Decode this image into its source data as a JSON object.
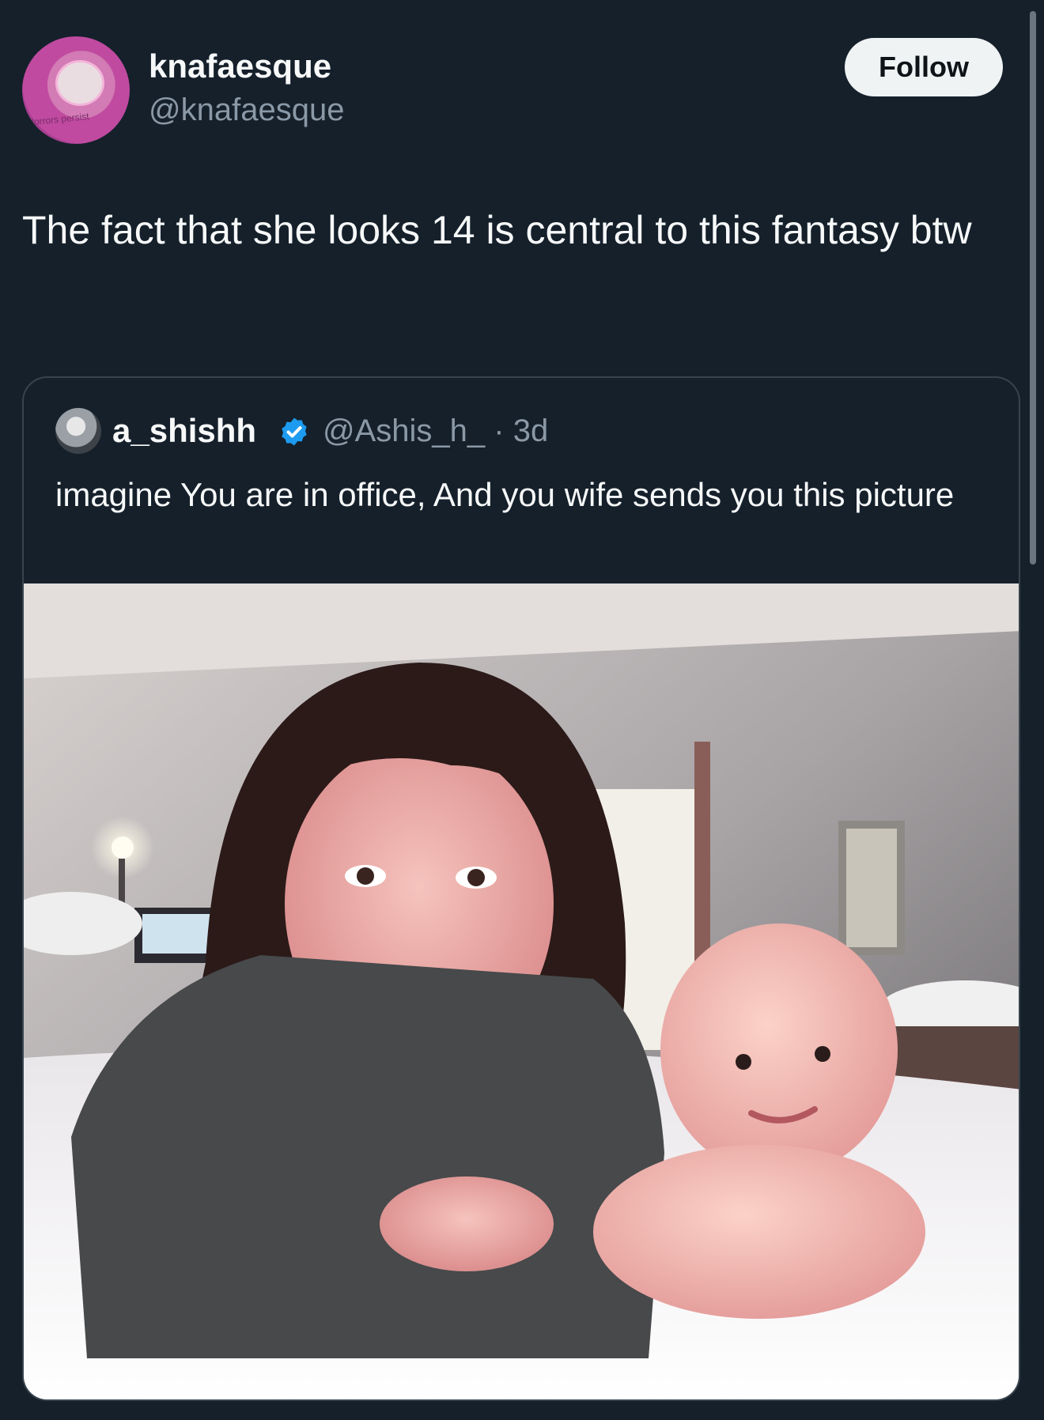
{
  "tweet": {
    "display_name": "knafaesque",
    "handle": "@knafaesque",
    "follow_label": "Follow",
    "avatar_text": "Horrors persist",
    "text": "The fact that she looks 14 is central to this fantasy btw"
  },
  "quote": {
    "display_name": "a_shishh",
    "handle_time": "@Ashis_h_ · 3d",
    "text": "imagine You are in office, And you wife sends you this picture",
    "media_description": "photo of a young woman and a baby lying on a bed"
  },
  "colors": {
    "background": "#15202b",
    "text_primary": "#f7f9f9",
    "text_secondary": "#8b98a5",
    "border": "#38444d",
    "verified": "#1d9bf0",
    "follow_button_bg": "#eff3f4"
  }
}
